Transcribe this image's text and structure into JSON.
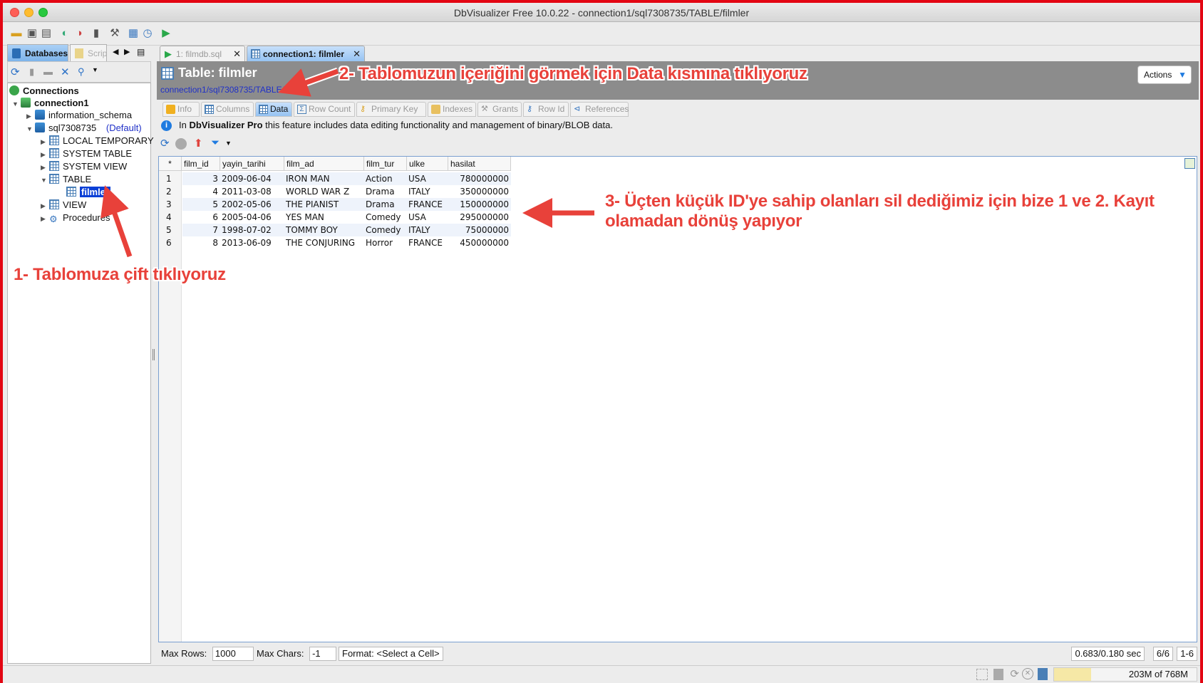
{
  "window": {
    "title": "DbVisualizer Free 10.0.22 - connection1/sql7308735/TABLE/filmler"
  },
  "left_tabs": [
    "Databases",
    "Scrip"
  ],
  "tree": {
    "root": "Connections",
    "connection": "connection1",
    "schema1": "information_schema",
    "schema2": "sql7308735",
    "schema2_badge": "(Default)",
    "items": [
      "LOCAL TEMPORARY",
      "SYSTEM TABLE",
      "SYSTEM VIEW",
      "TABLE",
      "filmler",
      "VIEW",
      "Procedures"
    ]
  },
  "doc_tabs": [
    "1: filmdb.sql",
    "connection1: filmler"
  ],
  "header": {
    "title": "Table: filmler",
    "path": "connection1/sql7308735/TABLE/filmler",
    "actions": "Actions"
  },
  "subtabs": [
    "Info",
    "Columns",
    "Data",
    "Row Count",
    "Primary Key",
    "Indexes",
    "Grants",
    "Row Id",
    "References"
  ],
  "info": {
    "prefix": "In",
    "product": "DbVisualizer Pro",
    "text": "this feature includes data editing functionality and management of binary/BLOB data."
  },
  "grid": {
    "corner": "*",
    "columns": [
      "film_id",
      "yayin_tarihi",
      "film_ad",
      "film_tur",
      "ulke",
      "hasilat"
    ],
    "rows": [
      {
        "n": "1",
        "cells": [
          "3",
          "2009-06-04",
          "IRON MAN",
          "Action",
          "USA",
          "780000000"
        ]
      },
      {
        "n": "2",
        "cells": [
          "4",
          "2011-03-08",
          "WORLD WAR Z",
          "Drama",
          "ITALY",
          "350000000"
        ]
      },
      {
        "n": "3",
        "cells": [
          "5",
          "2002-05-06",
          "THE PIANIST",
          "Drama",
          "FRANCE",
          "150000000"
        ]
      },
      {
        "n": "4",
        "cells": [
          "6",
          "2005-04-06",
          "YES MAN",
          "Comedy",
          "USA",
          "295000000"
        ]
      },
      {
        "n": "5",
        "cells": [
          "7",
          "1998-07-02",
          "TOMMY BOY",
          "Comedy",
          "ITALY",
          "75000000"
        ]
      },
      {
        "n": "6",
        "cells": [
          "8",
          "2013-06-09",
          "THE CONJURING",
          "Horror",
          "FRANCE",
          "450000000"
        ]
      }
    ]
  },
  "bottom": {
    "max_rows_label": "Max Rows:",
    "max_rows_value": "1000",
    "max_chars_label": "Max Chars:",
    "max_chars_value": "-1",
    "format": "Format: <Select a Cell>",
    "timing": "0.683/0.180 sec",
    "count": "6/6",
    "range": "1-6"
  },
  "status": {
    "memory": "203M of 768M"
  },
  "annotations": {
    "step1": "1- Tablomuza çift tıklıyoruz",
    "step2": "2- Tablomuzun içeriğini görmek için Data kısmına tıklıyoruz",
    "step3_line1": "3- Üçten küçük ID'ye sahip olanları sil dediğimiz için bize 1 ve 2. Kayıt",
    "step3_line2": "olamadan dönüş yapıyor"
  },
  "colors": {
    "annotation": "#e8413a",
    "border": "#e30613",
    "header_bg": "#8c8c8c",
    "selection": "#0a3fd6"
  }
}
